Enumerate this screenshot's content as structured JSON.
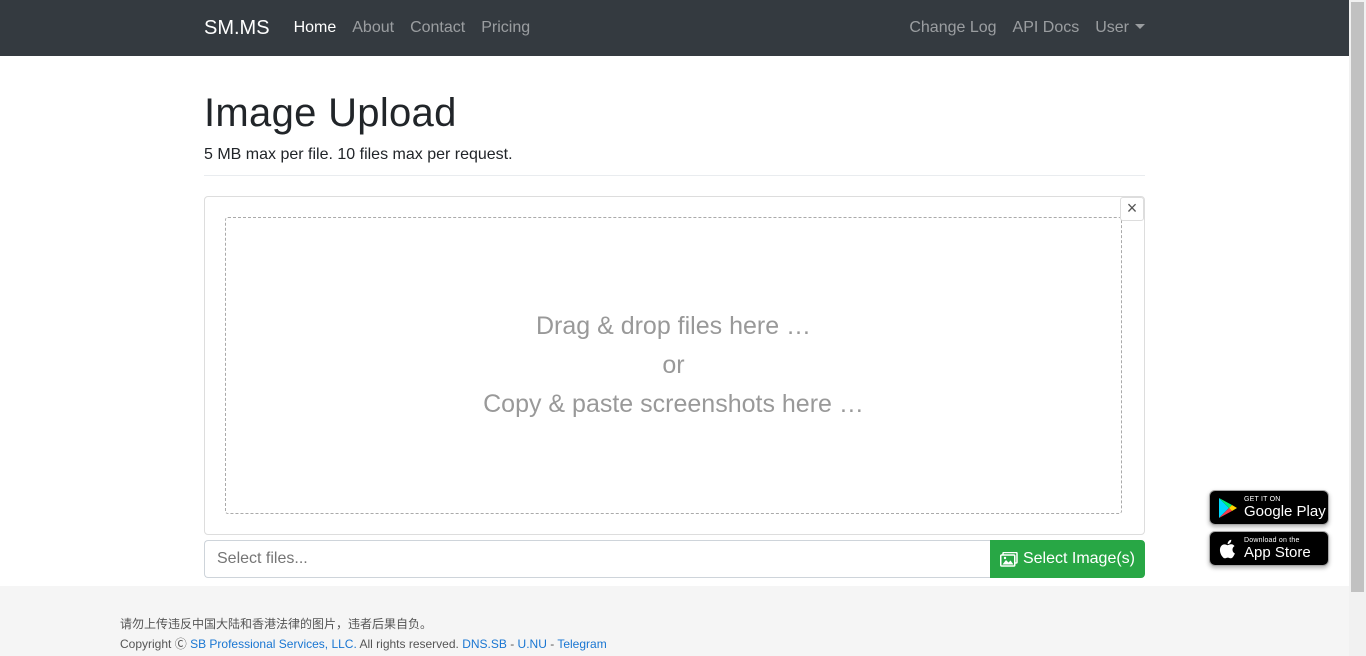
{
  "navbar": {
    "brand": "SM.MS",
    "links": [
      "Home",
      "About",
      "Contact",
      "Pricing"
    ],
    "right_links": [
      "Change Log",
      "API Docs",
      "User"
    ]
  },
  "main": {
    "title": "Image Upload",
    "subtitle": "5 MB max per file. 10 files max per request.",
    "dropzone": {
      "line1": "Drag & drop files here …",
      "line2": "or",
      "line3": "Copy & paste screenshots here …"
    },
    "close_label": "×",
    "file_placeholder": "Select files...",
    "select_button": "Select Image(s)"
  },
  "footer": {
    "notice": "请勿上传违反中国大陆和香港法律的图片，违者后果自负。",
    "copyright_prefix": "Copyright ",
    "copyright_symbol": "Ⓒ",
    "company": "SB Professional Services, LLC.",
    "rights": " All rights reserved. ",
    "links": [
      "DNS.SB",
      "U.NU",
      "Telegram"
    ],
    "separator": " - "
  },
  "badges": {
    "google_small": "GET IT ON",
    "google_big": "Google Play",
    "apple_small": "Download on the",
    "apple_big": "App Store"
  },
  "colors": {
    "navbar": "#343a40",
    "button": "#28a745",
    "link": "#1976d2"
  }
}
